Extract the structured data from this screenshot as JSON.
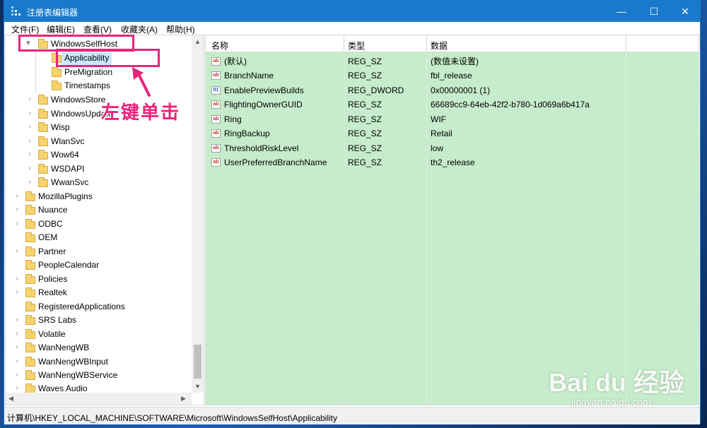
{
  "window": {
    "title": "注册表编辑器",
    "controls": {
      "minimize": "—",
      "maximize": "☐",
      "close": "✕"
    }
  },
  "menu": [
    "文件(F)",
    "编辑(E)",
    "查看(V)",
    "收藏夹(A)",
    "帮助(H)"
  ],
  "tree": {
    "items": [
      {
        "label": "WindowsSelfHost",
        "expanded": true
      },
      {
        "label": "Applicability",
        "selected": true
      },
      {
        "label": "PreMigration"
      },
      {
        "label": "Timestamps"
      },
      {
        "label": "WindowsStore"
      },
      {
        "label": "WindowsUpdate"
      },
      {
        "label": "Wisp"
      },
      {
        "label": "WlanSvc"
      },
      {
        "label": "Wow64"
      },
      {
        "label": "WSDAPI"
      },
      {
        "label": "WwanSvc"
      },
      {
        "label": "MozillaPlugins"
      },
      {
        "label": "Nuance"
      },
      {
        "label": "ODBC"
      },
      {
        "label": "OEM"
      },
      {
        "label": "Partner"
      },
      {
        "label": "PeopleCalendar"
      },
      {
        "label": "Policies"
      },
      {
        "label": "Realtek"
      },
      {
        "label": "RegisteredApplications"
      },
      {
        "label": "SRS Labs"
      },
      {
        "label": "Volatile"
      },
      {
        "label": "WanNengWB"
      },
      {
        "label": "WanNengWBInput"
      },
      {
        "label": "WanNengWBService"
      },
      {
        "label": "Waves Audio"
      }
    ]
  },
  "list": {
    "headers": {
      "name": "名称",
      "type": "类型",
      "data": "数据"
    },
    "rows": [
      {
        "icon": "ab",
        "name": "(默认)",
        "type": "REG_SZ",
        "data": "(数值未设置)"
      },
      {
        "icon": "ab",
        "name": "BranchName",
        "type": "REG_SZ",
        "data": "fbl_release"
      },
      {
        "icon": "bin",
        "name": "EnablePreviewBuilds",
        "type": "REG_DWORD",
        "data": "0x00000001 (1)"
      },
      {
        "icon": "ab",
        "name": "FlightingOwnerGUID",
        "type": "REG_SZ",
        "data": "66689cc9-64eb-42f2-b780-1d069a6b417a"
      },
      {
        "icon": "ab",
        "name": "Ring",
        "type": "REG_SZ",
        "data": "WIF"
      },
      {
        "icon": "ab",
        "name": "RingBackup",
        "type": "REG_SZ",
        "data": "Retail"
      },
      {
        "icon": "ab",
        "name": "ThresholdRiskLevel",
        "type": "REG_SZ",
        "data": "low"
      },
      {
        "icon": "ab",
        "name": "UserPreferredBranchName",
        "type": "REG_SZ",
        "data": "th2_release"
      }
    ]
  },
  "status": "计算机\\HKEY_LOCAL_MACHINE\\SOFTWARE\\Microsoft\\WindowsSelfHost\\Applicability",
  "annotation": {
    "text": "左键单击",
    "color": "#e8247a"
  },
  "watermark": {
    "main": "Bai du 经验",
    "sub": "jingyan.baidu.com"
  },
  "colors": {
    "titlebar": "#1979ca",
    "list_bg": "#c6eccb",
    "selection": "#cce8ff"
  }
}
